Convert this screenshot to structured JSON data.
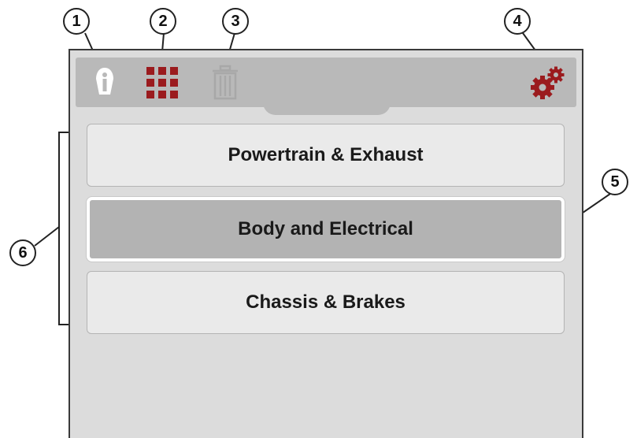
{
  "callouts": [
    "1",
    "2",
    "3",
    "4",
    "5",
    "6"
  ],
  "toolbar": {
    "info_icon": "info-icon",
    "grid_icon": "grid-icon",
    "trash_icon": "trash-icon",
    "settings_icon": "gears-icon"
  },
  "menu": {
    "items": [
      {
        "label": "Powertrain & Exhaust",
        "selected": false
      },
      {
        "label": "Body and Electrical",
        "selected": true
      },
      {
        "label": "Chassis & Brakes",
        "selected": false
      }
    ]
  },
  "colors": {
    "accent": "#9b1b1e",
    "toolbar": "#b9b9b9",
    "panel": "#dcdcdc",
    "button": "#eaeaea",
    "selected_button": "#b3b3b3",
    "disabled_icon": "#a8a8a8"
  }
}
